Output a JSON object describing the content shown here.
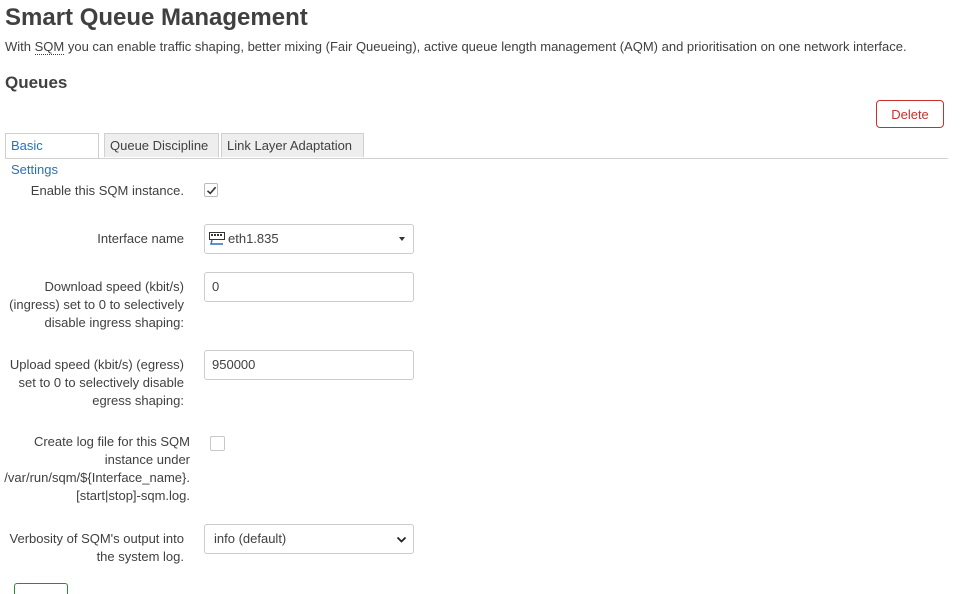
{
  "header": {
    "title": "Smart Queue Management",
    "desc_prefix": "With ",
    "desc_abbr": "SQM",
    "desc_suffix": " you can enable traffic shaping, better mixing (Fair Queueing), active queue length management (AQM) and prioritisation on one network interface."
  },
  "section": {
    "title": "Queues",
    "delete_label": "Delete"
  },
  "tabs": [
    {
      "label": "Basic Settings",
      "active": true
    },
    {
      "label": "Queue Discipline",
      "active": false
    },
    {
      "label": "Link Layer Adaptation",
      "active": false
    }
  ],
  "form": {
    "enable": {
      "label": "Enable this SQM instance.",
      "checked": true
    },
    "interface": {
      "label": "Interface name",
      "value": "eth1.835",
      "icon": "ethernet-port-icon"
    },
    "download": {
      "label_1": "Download speed (kbit/s)",
      "label_2": "(ingress) set to 0 to selectively",
      "label_3": "disable ingress shaping:",
      "value": "0"
    },
    "upload": {
      "label_1": "Upload speed (kbit/s) (egress)",
      "label_2": "set to 0 to selectively disable",
      "label_3": "egress shaping:",
      "value": "950000"
    },
    "log": {
      "label_1": "Create log file for this SQM",
      "label_2": "instance under",
      "label_3": "/var/run/sqm/${Interface_name}.",
      "label_4": "[start|stop]-sqm.log.",
      "checked": false
    },
    "verbosity": {
      "label_1": "Verbosity of SQM's output into",
      "label_2": "the system log.",
      "value": "info (default)"
    }
  },
  "colors": {
    "accent": "#2673b8",
    "danger": "#c9302c",
    "text": "#404040"
  }
}
